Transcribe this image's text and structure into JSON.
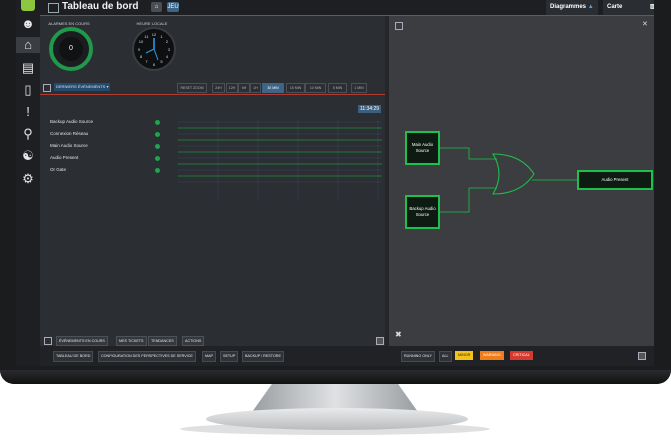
{
  "header": {
    "title": "Tableau de bord",
    "badge": "JEU",
    "diagrams_label": "Diagrammes",
    "map_label": "Carte"
  },
  "widgets": {
    "alarms_label": "ALARMES EN COURS",
    "alarms_count": "0",
    "clock_label": "HEURE LOCALE",
    "clock_numbers": [
      "12",
      "1",
      "2",
      "3",
      "4",
      "5",
      "6",
      "7",
      "8",
      "9",
      "10",
      "11"
    ]
  },
  "events": {
    "dropdown_label": "DERNIERS ÉVÉNEMENTS",
    "zoom_label": "RESET ZOOM",
    "ranges": [
      "24H",
      "12H",
      "6H",
      "1H",
      "30 MIN",
      "15 MIN",
      "10 MIN",
      "5 MIN",
      "1 MIN"
    ],
    "active_range": "30 MIN",
    "timestamp": "11:34:29",
    "rows": [
      "Backup Audio Source",
      "Connexion Réseau",
      "Main Audio Source",
      "Audio Present",
      "Or Gate"
    ]
  },
  "bottom_tabs": [
    "ÉVÉNEMENTS EN COURS",
    "MES TICKETS",
    "TENDANCES",
    "ACTIONS"
  ],
  "footer": {
    "nav": [
      "TABLEAU DE BORD",
      "CONFIGURATION DES PERSPECTIVES DE SERVICE",
      "MAP",
      "SETUP",
      "BACKUP / RESTORE"
    ],
    "running_only": "RUNNING ONLY",
    "all": "ALL",
    "minor": "MINOR",
    "warning": "WARNING",
    "critical": "CRITICAL"
  },
  "diagram": {
    "main_source": "Main Audio Source",
    "backup_source": "Backup Audio Source",
    "output": "Audio Present"
  },
  "colors": {
    "ok_green": "#1fbf4d",
    "accent_red": "#b13b2e",
    "minor": "#f2c21b",
    "warning": "#f07c1a",
    "critical": "#d63a2f"
  }
}
